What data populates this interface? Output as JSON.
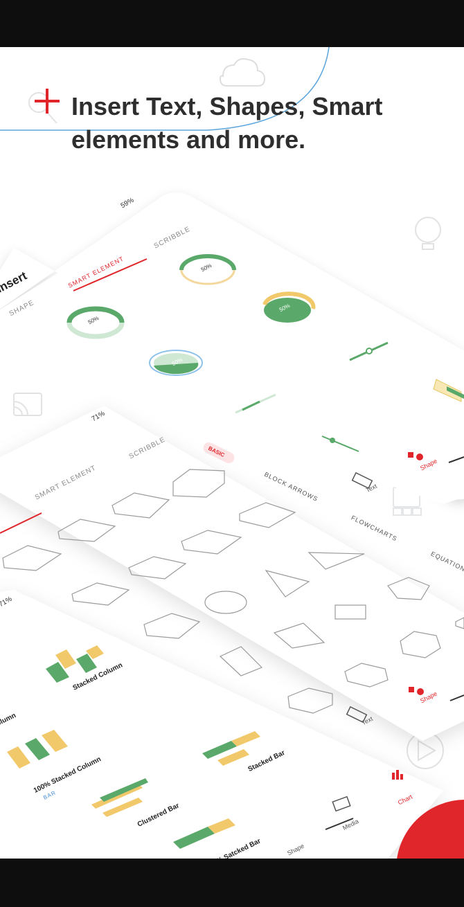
{
  "headline": {
    "line1": "Insert Text, Shapes,  Smart",
    "line2": "elements and more."
  },
  "colors": {
    "accent_red": "#e0262b",
    "green": "#5aa96a",
    "yellow": "#f1c86a",
    "text_dark": "#2e2e2e"
  },
  "screen1": {
    "status": "59%",
    "title": "Insert",
    "tabs": [
      "SHAPE",
      "SMART ELEMENT",
      "SCRIBBLE"
    ],
    "active_tab": "SMART ELEMENT",
    "gauge_labels": [
      "50%",
      "50%",
      "50%",
      "50%"
    ],
    "bottom_nav": [
      "Text",
      "Shape"
    ]
  },
  "screen2": {
    "status": "71%",
    "tabs": [
      "SMART ELEMENT",
      "SCRIBBLE"
    ],
    "badge": "BASIC",
    "categories": [
      "BLOCK ARROWS",
      "FLOWCHARTS",
      "EQUATION"
    ],
    "bottom_nav": [
      "Text",
      "Shape"
    ]
  },
  "screen3": {
    "status": "71%",
    "charts": [
      "Stacked Column",
      "olumn",
      "100% Stacked Column",
      "Stacked Bar",
      "Clustered Bar",
      "% Satcked Bar"
    ],
    "section": "BAR",
    "bottom_nav": [
      "Shape",
      "Media",
      "Chart"
    ]
  }
}
